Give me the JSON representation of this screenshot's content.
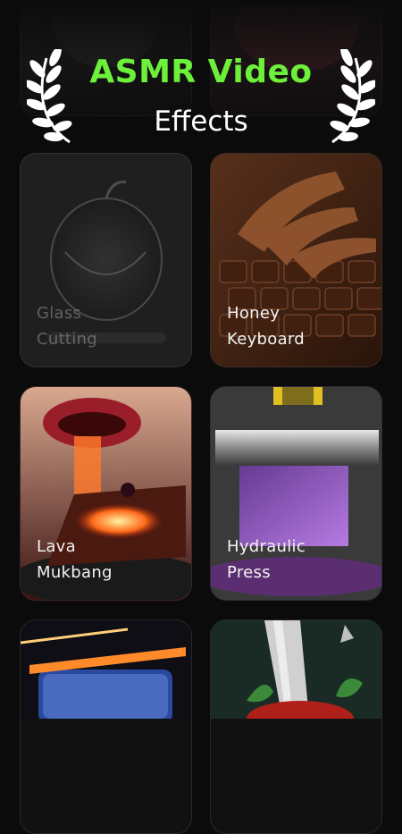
{
  "header": {
    "title": "ASMR Video",
    "subtitle": "Effects",
    "laurel_left_icon": "laurel-left-icon",
    "laurel_right_icon": "laurel-right-icon"
  },
  "effects": [
    {
      "line1": "Glass",
      "line2": "Cutting"
    },
    {
      "line1": "Honey",
      "line2": "Keyboard"
    },
    {
      "line1": "Lava",
      "line2": "Mukbang"
    },
    {
      "line1": "Hydraulic",
      "line2": "Press"
    }
  ],
  "colors": {
    "title_green": "#6df03a",
    "background": "#0b0b0b"
  }
}
